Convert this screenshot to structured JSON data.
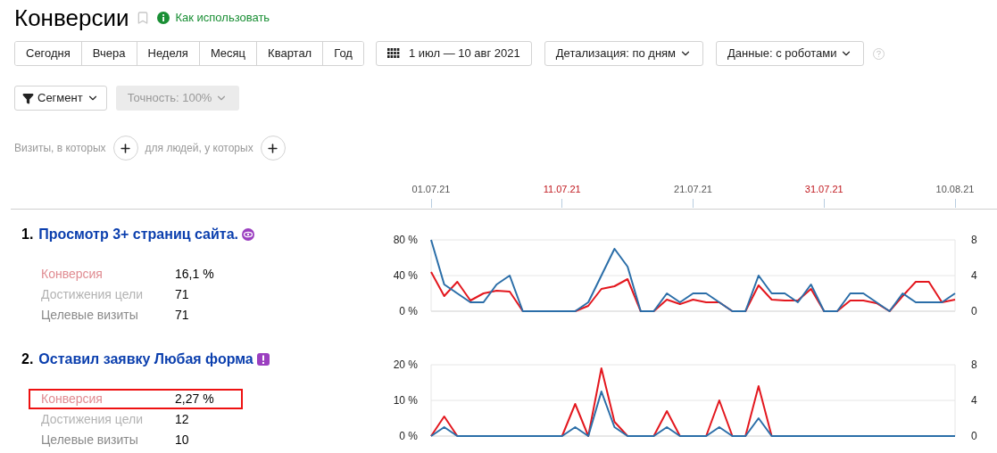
{
  "page": {
    "title": "Конверсии",
    "help_link": "Как использовать"
  },
  "periods": [
    {
      "label": "Сегодня",
      "selected": false
    },
    {
      "label": "Вчера",
      "selected": false
    },
    {
      "label": "Неделя",
      "selected": false
    },
    {
      "label": "Месяц",
      "selected": false
    },
    {
      "label": "Квартал",
      "selected": false
    },
    {
      "label": "Год",
      "selected": false
    }
  ],
  "date_range": "1 июл — 10 авг 2021",
  "dropdowns": [
    {
      "label": "Детализация: по дням"
    },
    {
      "label": "Данные: с роботами"
    }
  ],
  "segment_button": "Сегмент",
  "accuracy_button": {
    "label": "Точность: 100%",
    "disabled": true
  },
  "filters": [
    {
      "label": "Визиты, в которых"
    },
    {
      "label": "для людей, у которых"
    }
  ],
  "timeline": [
    {
      "label": "01.07.21",
      "weekend": false
    },
    {
      "label": "11.07.21",
      "weekend": true
    },
    {
      "label": "21.07.21",
      "weekend": false
    },
    {
      "label": "31.07.21",
      "weekend": true
    },
    {
      "label": "10.08.21",
      "weekend": false
    }
  ],
  "goals": [
    {
      "number": "1.",
      "title": "Просмотр 3+ страниц сайта.",
      "kind": "eye",
      "metrics": [
        {
          "kind": "conversion",
          "label": "Конверсия",
          "value": "16,1 %",
          "highlighted": false
        },
        {
          "kind": "reached",
          "label": "Достижения цели",
          "value": "71",
          "highlighted": false
        },
        {
          "kind": "visits",
          "label": "Целевые визиты",
          "value": "71",
          "highlighted": false
        }
      ],
      "chart_data": {
        "type": "line",
        "ylim": [
          0,
          80
        ],
        "yticks": [
          {
            "value": 0,
            "label": "0 %"
          },
          {
            "value": 40,
            "label": "40 %"
          },
          {
            "value": 80,
            "label": "80 %"
          }
        ],
        "y2lim": [
          0,
          8
        ],
        "y2ticks": [
          {
            "value": 0,
            "label": "0"
          },
          {
            "value": 4,
            "label": "4"
          },
          {
            "value": 8,
            "label": "8"
          }
        ],
        "series": [
          {
            "color": "#e3171e",
            "values": [
              44,
              17,
              33,
              12,
              20,
              23,
              22,
              0,
              null,
              null,
              null,
              0,
              6,
              25,
              28,
              36,
              0,
              0,
              13,
              8,
              13,
              10,
              10,
              0,
              0,
              29,
              13,
              12,
              12,
              25,
              0,
              0,
              12,
              12,
              9,
              0,
              17,
              33,
              33,
              10,
              13
            ]
          },
          {
            "color": "#2b6ea8",
            "axis": "y2",
            "values": [
              8,
              3,
              2,
              1,
              1,
              3,
              4,
              0,
              0,
              0,
              0,
              0,
              1,
              4,
              7,
              5,
              0,
              0,
              2,
              1,
              2,
              2,
              1,
              0,
              0,
              4,
              2,
              2,
              1,
              3,
              0,
              0,
              2,
              2,
              1,
              0,
              2,
              1,
              1,
              1,
              2
            ]
          }
        ]
      }
    },
    {
      "number": "2.",
      "title": "Оставил заявку Любая форма",
      "kind": "alert",
      "metrics": [
        {
          "kind": "conversion",
          "label": "Конверсия",
          "value": "2,27 %",
          "highlighted": true
        },
        {
          "kind": "reached",
          "label": "Достижения цели",
          "value": "12",
          "highlighted": false
        },
        {
          "kind": "visits",
          "label": "Целевые визиты",
          "value": "10",
          "highlighted": false
        }
      ],
      "chart_data": {
        "type": "line",
        "ylim": [
          0,
          20
        ],
        "yticks": [
          {
            "value": 0,
            "label": "0 %"
          },
          {
            "value": 10,
            "label": "10 %"
          },
          {
            "value": 20,
            "label": "20 %"
          }
        ],
        "y2lim": [
          0,
          8
        ],
        "y2ticks": [
          {
            "value": 0,
            "label": "0"
          },
          {
            "value": 4,
            "label": "4"
          },
          {
            "value": 8,
            "label": "8"
          }
        ],
        "series": [
          {
            "color": "#e3171e",
            "values": [
              0,
              5.5,
              0,
              null,
              null,
              null,
              null,
              null,
              null,
              null,
              0,
              9,
              0,
              19,
              4,
              0,
              null,
              0,
              7,
              0,
              null,
              0,
              10,
              0,
              0,
              14,
              0,
              null,
              null,
              null,
              null,
              null,
              null,
              null,
              null,
              null,
              null,
              null,
              null,
              null,
              null
            ]
          },
          {
            "color": "#2b6ea8",
            "axis": "y2",
            "values": [
              0,
              1,
              0,
              0,
              0,
              0,
              0,
              0,
              0,
              0,
              0,
              1,
              0,
              5,
              1,
              0,
              0,
              0,
              1,
              0,
              0,
              0,
              1,
              0,
              0,
              2,
              0,
              0,
              0,
              0,
              0,
              0,
              0,
              0,
              0,
              0,
              0,
              0,
              0,
              0,
              0
            ]
          }
        ]
      }
    }
  ]
}
